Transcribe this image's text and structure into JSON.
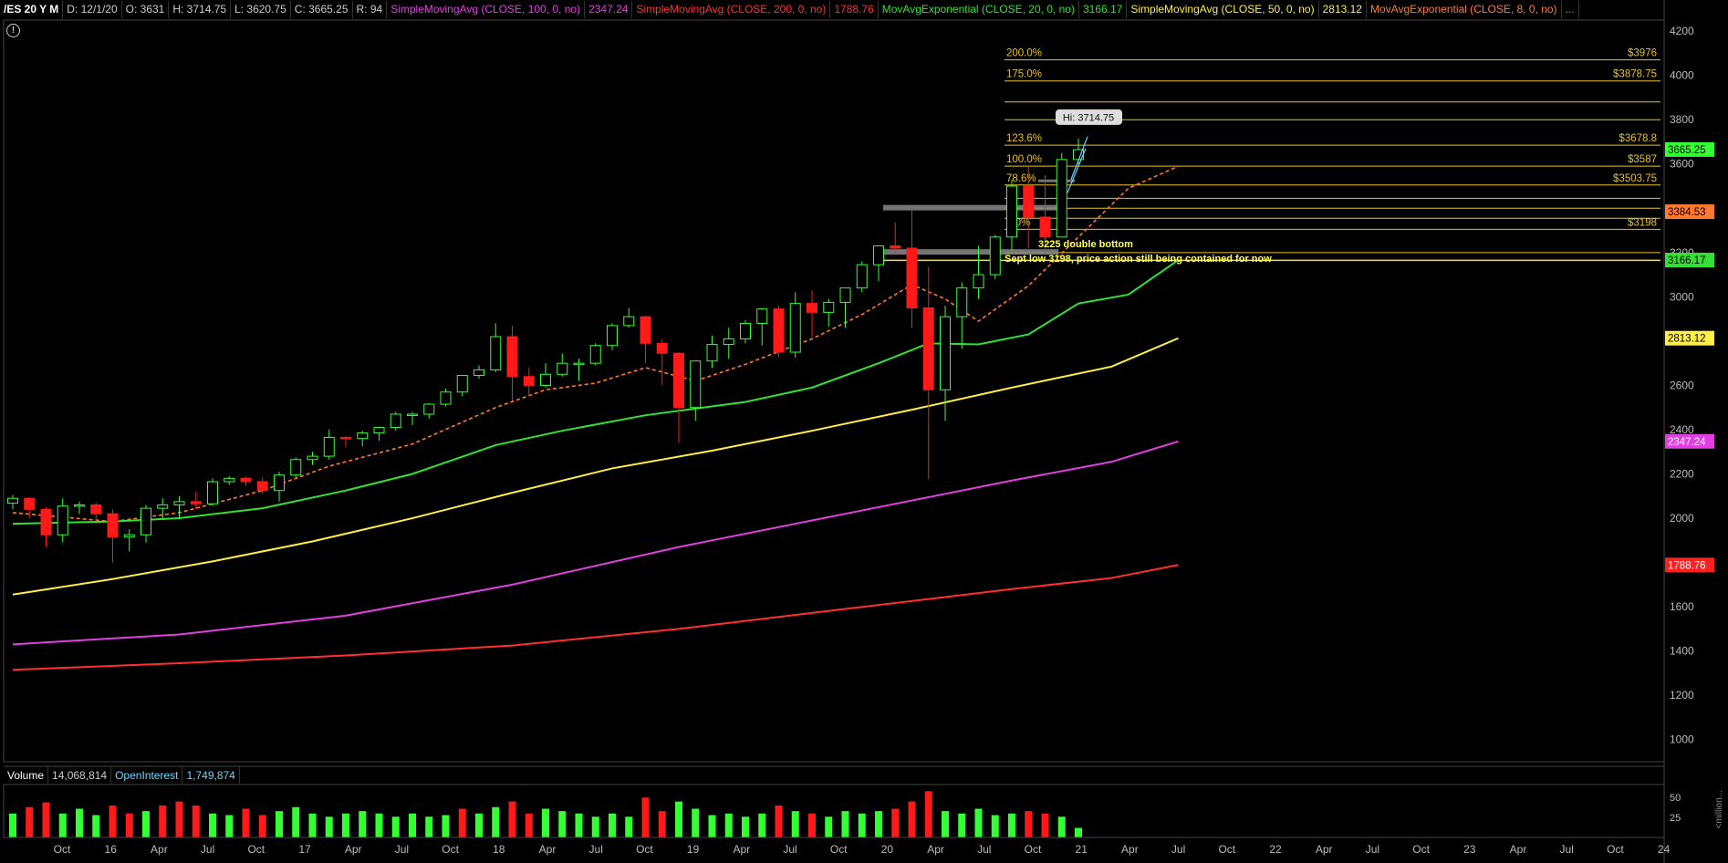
{
  "header": {
    "symbol": "/ES 20 Y M",
    "date": "D: 12/1/20",
    "open": "O: 3631",
    "high": "H: 3714.75",
    "low": "L: 3620.75",
    "close": "C: 3665.25",
    "range": "R: 94",
    "studies": [
      {
        "label": "SimpleMovingAvg (CLOSE, 100, 0, no)",
        "value": "2347.24",
        "color": "#e040e0"
      },
      {
        "label": "SimpleMovingAvg (CLOSE, 200, 0, no)",
        "value": "1788.76",
        "color": "#ff3030"
      },
      {
        "label": "MovAvgExponential (CLOSE, 20, 0, no)",
        "value": "3166.17",
        "color": "#33e033"
      },
      {
        "label": "SimpleMovingAvg (CLOSE, 50, 0, no)",
        "value": "2813.12",
        "color": "#ffee44"
      },
      {
        "label": "MovAvgExponential (CLOSE, 8, 0, no)",
        "value": "...",
        "color": "#ff7a30"
      }
    ]
  },
  "alert_icon": "!",
  "volume_header": {
    "volume_label": "Volume",
    "volume_value": "14,068,814",
    "oi_label": "OpenInterest",
    "oi_value": "1,749,874"
  },
  "vol_axis": {
    "ticks": [
      "50",
      "25"
    ],
    "unit_label": "<million..."
  },
  "annotations": {
    "hi_label": "Hi: 3714.75",
    "note1": "3225 double bottom",
    "note2": "Sept low 3198, price action still being contained for now"
  },
  "colors": {
    "bull": "#33ff33",
    "bear": "#ff1a1a",
    "fib": "#e6c229",
    "fib_text": "#e6c229"
  },
  "chart_data": {
    "type": "candlestick",
    "instrument": "/ES",
    "period": "monthly",
    "ylim": [
      900,
      4250
    ],
    "y_ticks": [
      1000,
      1200,
      1400,
      1600,
      1800,
      2000,
      2200,
      2400,
      2600,
      2800,
      3000,
      3200,
      3400,
      3600,
      3800,
      4000,
      4200
    ],
    "x_tick_labels": [
      "Oct",
      "16",
      "Apr",
      "Jul",
      "Oct",
      "17",
      "Apr",
      "Jul",
      "Oct",
      "18",
      "Apr",
      "Jul",
      "Oct",
      "19",
      "Apr",
      "Jul",
      "Oct",
      "20",
      "Apr",
      "Jul",
      "Oct",
      "21",
      "Apr",
      "Jul",
      "Oct",
      "22",
      "Apr",
      "Jul",
      "Oct",
      "23",
      "Apr",
      "Jul",
      "Oct",
      "24"
    ],
    "candles": [
      [
        2068,
        2105,
        2040,
        2090
      ],
      [
        2090,
        2095,
        2000,
        2040
      ],
      [
        2040,
        2050,
        1870,
        1925
      ],
      [
        1925,
        2090,
        1890,
        2055
      ],
      [
        2055,
        2075,
        2020,
        2060
      ],
      [
        2060,
        2070,
        1990,
        2020
      ],
      [
        2020,
        2040,
        1800,
        1915
      ],
      [
        1915,
        1950,
        1850,
        1925
      ],
      [
        1925,
        2060,
        1890,
        2045
      ],
      [
        2045,
        2090,
        2000,
        2060
      ],
      [
        2060,
        2100,
        1995,
        2075
      ],
      [
        2075,
        2120,
        2040,
        2065
      ],
      [
        2065,
        2180,
        2055,
        2165
      ],
      [
        2165,
        2190,
        2150,
        2180
      ],
      [
        2180,
        2190,
        2145,
        2165
      ],
      [
        2165,
        2185,
        2110,
        2125
      ],
      [
        2125,
        2210,
        2075,
        2195
      ],
      [
        2195,
        2275,
        2185,
        2265
      ],
      [
        2265,
        2300,
        2240,
        2280
      ],
      [
        2280,
        2400,
        2265,
        2365
      ],
      [
        2365,
        2370,
        2320,
        2360
      ],
      [
        2360,
        2395,
        2325,
        2385
      ],
      [
        2385,
        2410,
        2350,
        2410
      ],
      [
        2410,
        2480,
        2395,
        2470
      ],
      [
        2470,
        2480,
        2420,
        2470
      ],
      [
        2470,
        2520,
        2450,
        2515
      ],
      [
        2515,
        2585,
        2505,
        2570
      ],
      [
        2570,
        2600,
        2550,
        2645
      ],
      [
        2645,
        2690,
        2630,
        2670
      ],
      [
        2670,
        2880,
        2660,
        2820
      ],
      [
        2820,
        2870,
        2530,
        2640
      ],
      [
        2640,
        2680,
        2550,
        2600
      ],
      [
        2600,
        2700,
        2590,
        2650
      ],
      [
        2650,
        2745,
        2640,
        2700
      ],
      [
        2700,
        2720,
        2620,
        2700
      ],
      [
        2700,
        2790,
        2690,
        2780
      ],
      [
        2780,
        2880,
        2760,
        2870
      ],
      [
        2870,
        2950,
        2860,
        2910
      ],
      [
        2910,
        2915,
        2700,
        2790
      ],
      [
        2790,
        2810,
        2600,
        2745
      ],
      [
        2745,
        2750,
        2340,
        2500
      ],
      [
        2500,
        2710,
        2440,
        2710
      ],
      [
        2710,
        2825,
        2680,
        2785
      ],
      [
        2785,
        2860,
        2720,
        2810
      ],
      [
        2810,
        2895,
        2790,
        2880
      ],
      [
        2880,
        2950,
        2780,
        2945
      ],
      [
        2945,
        2960,
        2730,
        2750
      ],
      [
        2750,
        3020,
        2725,
        2970
      ],
      [
        2970,
        3030,
        2820,
        2930
      ],
      [
        2930,
        2990,
        2865,
        2975
      ],
      [
        2975,
        3035,
        2860,
        3040
      ],
      [
        3040,
        3160,
        3020,
        3145
      ],
      [
        3145,
        3185,
        3070,
        3230
      ],
      [
        3230,
        3335,
        3200,
        3220
      ],
      [
        3220,
        3400,
        2860,
        2950
      ],
      [
        2950,
        3135,
        2175,
        2580
      ],
      [
        2580,
        2960,
        2440,
        2910
      ],
      [
        2910,
        3065,
        2765,
        3040
      ],
      [
        3040,
        3230,
        2990,
        3100
      ],
      [
        3100,
        3280,
        3080,
        3270
      ],
      [
        3270,
        3530,
        3210,
        3500
      ],
      [
        3500,
        3590,
        3220,
        3360
      ],
      [
        3360,
        3550,
        3200,
        3270
      ],
      [
        3270,
        3650,
        3280,
        3620
      ],
      [
        3620,
        3715,
        3600,
        3665
      ]
    ],
    "ma_series": [
      {
        "name": "MovAvgExponential (CLOSE, 8, 0, no)",
        "color": "#ff7a30",
        "dashed": true,
        "points": [
          [
            0,
            2025
          ],
          [
            6,
            1985
          ],
          [
            10,
            2025
          ],
          [
            15,
            2125
          ],
          [
            19,
            2235
          ],
          [
            24,
            2335
          ],
          [
            29,
            2500
          ],
          [
            32,
            2580
          ],
          [
            35,
            2610
          ],
          [
            38,
            2680
          ],
          [
            41,
            2620
          ],
          [
            44,
            2695
          ],
          [
            48,
            2810
          ],
          [
            51,
            2920
          ],
          [
            54,
            3055
          ],
          [
            56,
            2990
          ],
          [
            58,
            2890
          ],
          [
            61,
            3050
          ],
          [
            64,
            3270
          ],
          [
            67,
            3490
          ],
          [
            70,
            3590
          ]
        ]
      },
      {
        "name": "MovAvgExponential (CLOSE, 20, 0, no)",
        "value": 3166.17,
        "color": "#33e033",
        "points": [
          [
            0,
            1975
          ],
          [
            6,
            1985
          ],
          [
            10,
            2000
          ],
          [
            15,
            2045
          ],
          [
            20,
            2125
          ],
          [
            24,
            2200
          ],
          [
            29,
            2330
          ],
          [
            33,
            2395
          ],
          [
            38,
            2465
          ],
          [
            41,
            2495
          ],
          [
            44,
            2525
          ],
          [
            48,
            2590
          ],
          [
            52,
            2700
          ],
          [
            55,
            2790
          ],
          [
            58,
            2785
          ],
          [
            61,
            2830
          ],
          [
            64,
            2970
          ],
          [
            67,
            3010
          ],
          [
            70,
            3166
          ]
        ]
      },
      {
        "name": "SimpleMovingAvg (CLOSE, 50, 0, no)",
        "value": 2813.12,
        "color": "#ffee44",
        "points": [
          [
            0,
            1655
          ],
          [
            6,
            1725
          ],
          [
            12,
            1805
          ],
          [
            18,
            1895
          ],
          [
            24,
            2000
          ],
          [
            30,
            2115
          ],
          [
            36,
            2225
          ],
          [
            42,
            2305
          ],
          [
            48,
            2395
          ],
          [
            54,
            2490
          ],
          [
            60,
            2590
          ],
          [
            66,
            2685
          ],
          [
            70,
            2813
          ]
        ]
      },
      {
        "name": "SimpleMovingAvg (CLOSE, 100, 0, no)",
        "value": 2347.24,
        "color": "#e040e0",
        "points": [
          [
            0,
            1430
          ],
          [
            10,
            1475
          ],
          [
            20,
            1560
          ],
          [
            30,
            1700
          ],
          [
            40,
            1870
          ],
          [
            50,
            2020
          ],
          [
            60,
            2170
          ],
          [
            66,
            2255
          ],
          [
            70,
            2347
          ]
        ]
      },
      {
        "name": "SimpleMovingAvg (CLOSE, 200, 0, no)",
        "value": 1788.76,
        "color": "#ff3030",
        "points": [
          [
            0,
            1315
          ],
          [
            10,
            1345
          ],
          [
            20,
            1380
          ],
          [
            30,
            1425
          ],
          [
            40,
            1500
          ],
          [
            50,
            1590
          ],
          [
            60,
            1680
          ],
          [
            66,
            1730
          ],
          [
            70,
            1789
          ]
        ]
      }
    ],
    "fib_levels": [
      {
        "pct": "200.0%",
        "price": 4070,
        "label": "$3976"
      },
      {
        "pct": "175.0%",
        "price": 3975,
        "label": "$3878.75"
      },
      {
        "pct": "",
        "price": 3880,
        "label": ""
      },
      {
        "pct": "",
        "price": 3800,
        "label": ""
      },
      {
        "pct": "123.6%",
        "price": 3685,
        "label": "$3678.8"
      },
      {
        "pct": "100.0%",
        "price": 3590,
        "label": "$3587"
      },
      {
        "pct": "78.6%",
        "price": 3505,
        "label": "$3503.75"
      },
      {
        "pct": "",
        "price": 3445,
        "label": ""
      },
      {
        "pct": "",
        "price": 3400,
        "label": ""
      },
      {
        "pct": "",
        "price": 3355,
        "label": ""
      },
      {
        "pct": "0.0%",
        "price": 3305,
        "label": "$3198"
      },
      {
        "pct": "",
        "price": 3200,
        "label": ""
      }
    ],
    "price_badges": [
      {
        "label": "3665.25",
        "price": 3665.25,
        "bg": "#33ff33",
        "fg": "#000"
      },
      {
        "label": "3384.53",
        "price": 3384.53,
        "bg": "#ff7a30",
        "fg": "#000"
      },
      {
        "label": "3166.17",
        "price": 3166.17,
        "bg": "#33e033",
        "fg": "#000"
      },
      {
        "label": "2813.12",
        "price": 2813.12,
        "bg": "#ffee44",
        "fg": "#000"
      },
      {
        "label": "2347.24",
        "price": 2347.24,
        "bg": "#e040e0",
        "fg": "#fff"
      },
      {
        "label": "1788.76",
        "price": 1788.76,
        "bg": "#ff2020",
        "fg": "#fff"
      }
    ],
    "volume": [
      [
        30,
        "g"
      ],
      [
        38,
        "r"
      ],
      [
        44,
        "r"
      ],
      [
        30,
        "g"
      ],
      [
        36,
        "g"
      ],
      [
        28,
        "g"
      ],
      [
        40,
        "r"
      ],
      [
        30,
        "r"
      ],
      [
        33,
        "g"
      ],
      [
        40,
        "r"
      ],
      [
        45,
        "r"
      ],
      [
        40,
        "r"
      ],
      [
        30,
        "g"
      ],
      [
        28,
        "g"
      ],
      [
        36,
        "r"
      ],
      [
        28,
        "r"
      ],
      [
        33,
        "g"
      ],
      [
        38,
        "g"
      ],
      [
        30,
        "g"
      ],
      [
        26,
        "g"
      ],
      [
        30,
        "g"
      ],
      [
        33,
        "g"
      ],
      [
        30,
        "g"
      ],
      [
        26,
        "g"
      ],
      [
        30,
        "g"
      ],
      [
        26,
        "g"
      ],
      [
        28,
        "g"
      ],
      [
        36,
        "r"
      ],
      [
        30,
        "g"
      ],
      [
        38,
        "g"
      ],
      [
        45,
        "r"
      ],
      [
        30,
        "r"
      ],
      [
        36,
        "g"
      ],
      [
        33,
        "g"
      ],
      [
        30,
        "g"
      ],
      [
        26,
        "g"
      ],
      [
        30,
        "g"
      ],
      [
        26,
        "g"
      ],
      [
        50,
        "r"
      ],
      [
        33,
        "r"
      ],
      [
        45,
        "g"
      ],
      [
        36,
        "g"
      ],
      [
        28,
        "g"
      ],
      [
        30,
        "g"
      ],
      [
        26,
        "g"
      ],
      [
        30,
        "g"
      ],
      [
        40,
        "r"
      ],
      [
        33,
        "g"
      ],
      [
        30,
        "r"
      ],
      [
        26,
        "g"
      ],
      [
        33,
        "g"
      ],
      [
        30,
        "g"
      ],
      [
        33,
        "g"
      ],
      [
        36,
        "r"
      ],
      [
        45,
        "r"
      ],
      [
        58,
        "r"
      ],
      [
        33,
        "g"
      ],
      [
        30,
        "g"
      ],
      [
        36,
        "g"
      ],
      [
        28,
        "g"
      ],
      [
        30,
        "g"
      ],
      [
        33,
        "r"
      ],
      [
        30,
        "r"
      ],
      [
        26,
        "g"
      ],
      [
        12,
        "g"
      ]
    ]
  }
}
